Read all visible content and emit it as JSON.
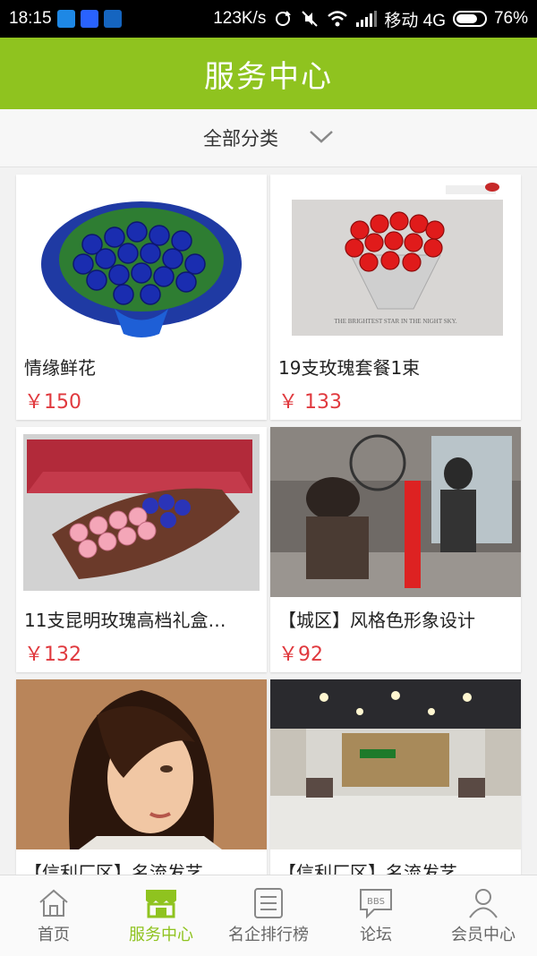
{
  "status_bar": {
    "time": "18:15",
    "speed": "123K/s",
    "carrier": "移动 4G",
    "battery": "76%",
    "battery_level": 0.76
  },
  "header": {
    "title": "服务中心"
  },
  "filter": {
    "label": "全部分类"
  },
  "products": [
    {
      "name": "情缘鲜花",
      "price": "￥150",
      "image": "blue-roses-bouquet"
    },
    {
      "name": "19支玫瑰套餐1束",
      "price": "￥ 133",
      "image": "red-roses-bouquet"
    },
    {
      "name": "11支昆明玫瑰高档礼盒…",
      "price": "￥132",
      "image": "rose-gift-box"
    },
    {
      "name": "【城区】风格色形象设计",
      "price": "￥92",
      "image": "hair-salon-interior"
    },
    {
      "name": "【信利厂区】名流发艺",
      "price": "",
      "image": "woman-hairstyle"
    },
    {
      "name": "【信利厂区】名流发艺",
      "price": "",
      "image": "salon-hall"
    }
  ],
  "tabbar": {
    "items": [
      {
        "label": "首页",
        "icon": "home-icon",
        "active": false
      },
      {
        "label": "服务中心",
        "icon": "store-icon",
        "active": true
      },
      {
        "label": "名企排行榜",
        "icon": "list-icon",
        "active": false
      },
      {
        "label": "论坛",
        "icon": "bbs-icon",
        "active": false
      },
      {
        "label": "会员中心",
        "icon": "user-icon",
        "active": false
      }
    ],
    "bbs_badge": "BBS"
  },
  "colors": {
    "accent": "#8fc31f",
    "price": "#e0393e"
  }
}
